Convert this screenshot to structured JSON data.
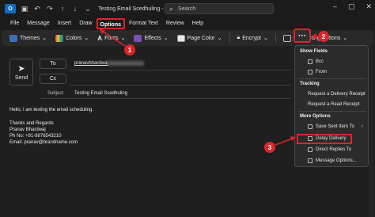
{
  "titlebar": {
    "app_icon": "outlook-icon",
    "title": "Testing Email Scedhuling  -  Message (H...",
    "search_placeholder": "Search"
  },
  "menu": [
    "File",
    "Message",
    "Insert",
    "Draw",
    "Options",
    "Format Text",
    "Review",
    "Help"
  ],
  "ribbon": {
    "themes": "Themes",
    "colors": "Colors",
    "fonts": "Fonts",
    "effects": "Effects",
    "page_color": "Page Color",
    "encrypt": "Encrypt",
    "voting": "Use Voting Buttons",
    "more": "···"
  },
  "compose": {
    "send": "Send",
    "to_label": "To",
    "cc_label": "Cc",
    "to_value": "pranavbhardwaj",
    "subject_label": "Subject",
    "subject_value": "Testing Email Scedhuling",
    "body": [
      "Hello, I am testing the email scheduling.",
      "",
      "Thanks and Regards",
      "Pranav Bhardwaj",
      "Ph No: +91-9876543210",
      "Email: pranav@brandname.com"
    ]
  },
  "dropdown": {
    "show_fields": "Show Fields",
    "bcc": "Bcc",
    "from": "From",
    "tracking": "Tracking",
    "delivery_receipt": "Request a Delivery Receipt",
    "read_receipt": "Request a Read Receipt",
    "more_options": "More Options",
    "save_sent": "Save Sent Item To",
    "delay_delivery": "Delay Delivery",
    "direct_replies": "Direct Replies To",
    "message_options": "Message Options..."
  },
  "callouts": [
    "1",
    "2",
    "3"
  ],
  "colors": {
    "accent_red": "#d9262a",
    "brand_blue": "#0f6cbd"
  }
}
